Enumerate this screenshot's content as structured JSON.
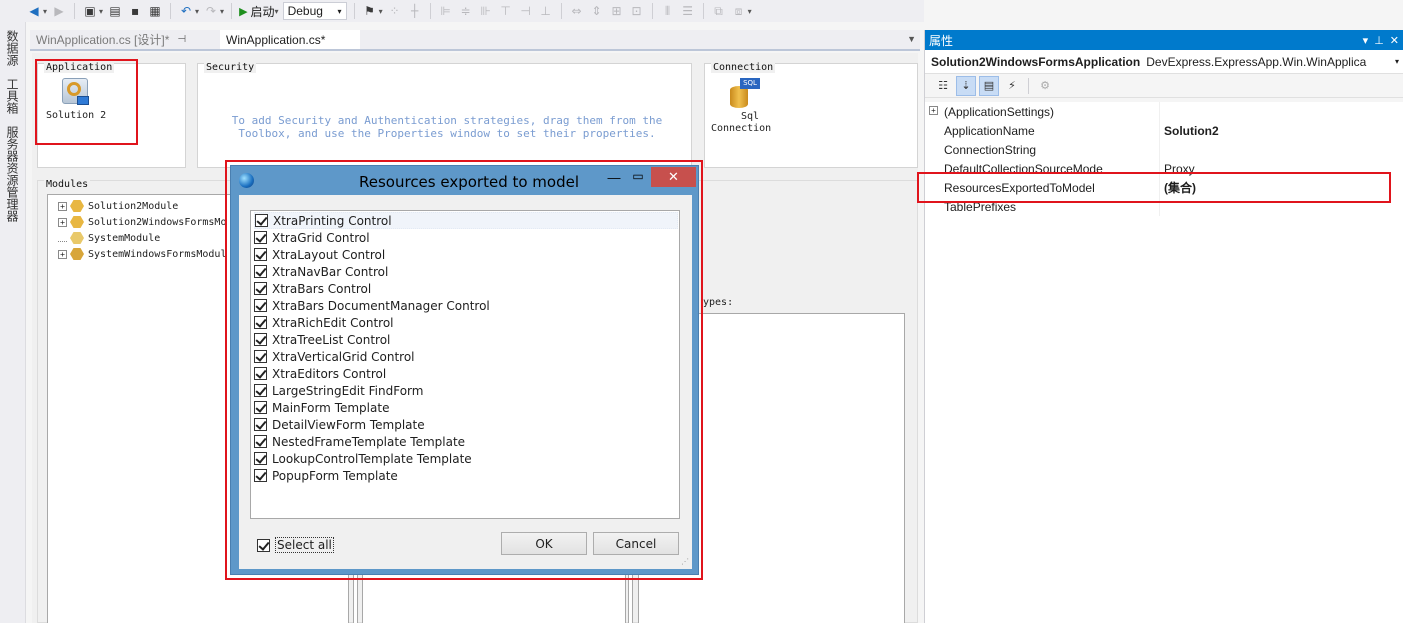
{
  "toolbar": {
    "run_label": "启动",
    "config": "Debug"
  },
  "left_strip": {
    "tabs": [
      "数据源",
      "工具箱",
      "服务器资源管理器"
    ]
  },
  "tabs": [
    {
      "label": "WinApplication.cs [设计]*",
      "active": false
    },
    {
      "label": "WinApplication.cs*",
      "active": true
    }
  ],
  "designer": {
    "application": {
      "label": "Application",
      "item": "Solution 2"
    },
    "security": {
      "label": "Security",
      "hint": "To add Security and Authentication strategies, drag them from the Toolbox, and use the Properties window to set their properties."
    },
    "connection": {
      "label": "Connection",
      "item_line1": "Sql",
      "item_line2": "Connection",
      "icon_text": "SQL"
    },
    "modules": {
      "label": "Modules",
      "items": [
        "Solution2Module",
        "Solution2WindowsFormsMo",
        "SystemModule",
        "SystemWindowsFormsModul"
      ]
    },
    "types_label": "ypes:"
  },
  "properties": {
    "title": "属性",
    "object_name": "Solution2WindowsFormsApplication",
    "object_type": "DevExpress.ExpressApp.Win.WinApplica",
    "rows": [
      {
        "name": "(ApplicationSettings)",
        "value": "",
        "expandable": true
      },
      {
        "name": "ApplicationName",
        "value": "Solution2"
      },
      {
        "name": "ConnectionString",
        "value": ""
      },
      {
        "name": "DefaultCollectionSourceMode",
        "value": "Proxy"
      },
      {
        "name": "ResourcesExportedToModel",
        "value": "(集合)"
      },
      {
        "name": "TablePrefixes",
        "value": ""
      }
    ]
  },
  "dialog": {
    "title": "Resources exported to model",
    "close": "✕",
    "items": [
      "XtraPrinting Control",
      "XtraGrid Control",
      "XtraLayout Control",
      "XtraNavBar Control",
      "XtraBars Control",
      "XtraBars DocumentManager Control",
      "XtraRichEdit Control",
      "XtraTreeList Control",
      "XtraVerticalGrid Control",
      "XtraEditors Control",
      "LargeStringEdit FindForm",
      "MainForm Template",
      "DetailViewForm Template",
      "NestedFrameTemplate Template",
      "LookupControlTemplate Template",
      "PopupForm Template"
    ],
    "select_all": "Select all",
    "ok": "OK",
    "cancel": "Cancel"
  }
}
